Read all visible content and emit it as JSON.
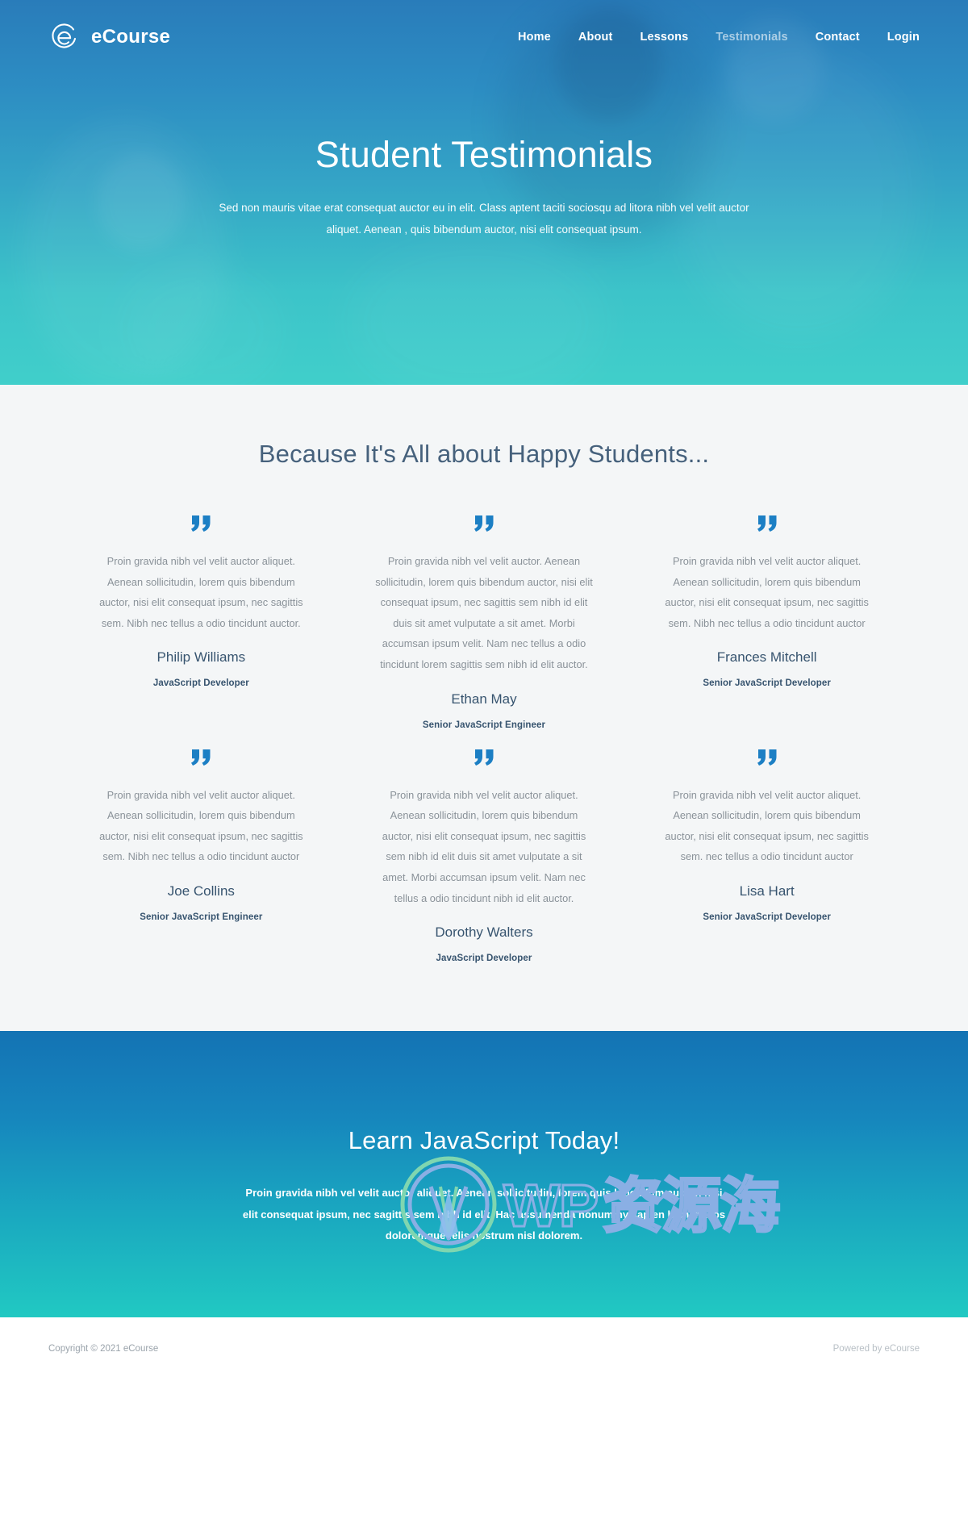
{
  "brand": {
    "name": "eCourse",
    "logo_icon": "ecourse-e-mark-icon"
  },
  "nav": {
    "items": [
      {
        "label": "Home",
        "active": false
      },
      {
        "label": "About",
        "active": false
      },
      {
        "label": "Lessons",
        "active": false
      },
      {
        "label": "Testimonials",
        "active": true
      },
      {
        "label": "Contact",
        "active": false
      },
      {
        "label": "Login",
        "active": false
      }
    ]
  },
  "hero": {
    "title": "Student Testimonials",
    "subtitle": "Sed non mauris vitae erat consequat auctor eu in elit. Class aptent taciti sociosqu ad litora nibh vel velit auctor aliquet. Aenean , quis bibendum auctor, nisi elit consequat ipsum."
  },
  "testimonials_section": {
    "heading": "Because It's All about Happy Students...",
    "quote_icon": "quotation-mark-icon",
    "quote_color": "#1c7fc4",
    "cards": [
      {
        "text": "Proin gravida nibh vel velit auctor aliquet. Aenean sollicitudin, lorem quis bibendum auctor, nisi elit consequat ipsum, nec sagittis sem. Nibh  nec tellus a odio tincidunt auctor.",
        "name": "Philip Williams",
        "role": "JavaScript Developer"
      },
      {
        "text": "Proin gravida nibh vel velit auctor. Aenean sollicitudin, lorem quis bibendum auctor, nisi elit consequat ipsum, nec sagittis sem nibh id elit duis sit amet vulputate a sit amet. Morbi accumsan ipsum velit. Nam nec tellus a odio tincidunt lorem sagittis sem nibh id elit auctor.",
        "name": "Ethan May",
        "role": "Senior JavaScript Engineer"
      },
      {
        "text": "Proin gravida nibh vel velit auctor aliquet. Aenean sollicitudin, lorem quis bibendum auctor, nisi elit consequat ipsum, nec sagittis sem. Nibh nec tellus a odio tincidunt auctor",
        "name": "Frances Mitchell",
        "role": "Senior JavaScript Developer"
      },
      {
        "text": "Proin gravida nibh vel velit auctor aliquet. Aenean sollicitudin, lorem quis bibendum auctor, nisi elit consequat ipsum, nec sagittis sem. Nibh nec tellus a odio tincidunt auctor",
        "name": "Joe Collins",
        "role": "Senior JavaScript Engineer"
      },
      {
        "text": "Proin gravida nibh vel velit auctor aliquet. Aenean sollicitudin, lorem quis bibendum auctor, nisi elit consequat ipsum, nec sagittis sem nibh id elit duis sit amet vulputate a sit amet. Morbi accumsan ipsum velit. Nam nec tellus a odio tincidunt nibh id elit auctor.",
        "name": "Dorothy Walters",
        "role": "JavaScript Developer"
      },
      {
        "text": "Proin gravida nibh vel velit auctor aliquet. Aenean sollicitudin, lorem quis bibendum auctor, nisi elit consequat ipsum, nec sagittis sem. nec tellus a odio tincidunt auctor",
        "name": "Lisa Hart",
        "role": "Senior JavaScript Developer"
      }
    ]
  },
  "cta": {
    "title": "Learn JavaScript Today!",
    "text": "Proin gravida nibh vel velit auctor aliquet. Aenean sollicitudin, lorem quis bibendum auctor, nisi elit consequat ipsum, nec sagittis sem nibh id elit. Hac assumenda nonummy sapien hymenaeos doloremque felis nostrum nisl dolorem."
  },
  "footer": {
    "copyright": "Copyright © 2021 eCourse",
    "powered_by": "Powered by eCourse"
  },
  "watermark": {
    "wp": "WP",
    "cn": "资源海",
    "logo_icon": "wordpress-logo-icon"
  }
}
